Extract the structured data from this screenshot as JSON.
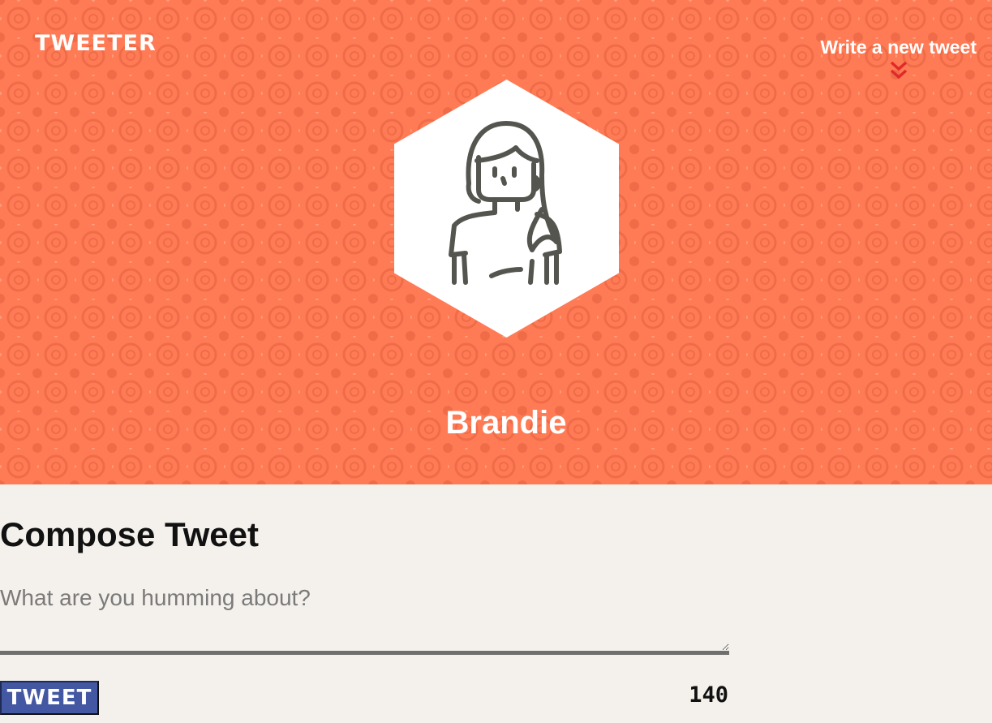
{
  "colors": {
    "header_background": "#ff7b55",
    "page_background": "#f4f1ec",
    "tweet_button": "#4357a2",
    "chevron": "#e02a2a"
  },
  "nav": {
    "brand": "TWEETER",
    "compose_link": "Write a new tweet",
    "compose_icon": "double-chevron-down-icon"
  },
  "profile": {
    "avatar_icon": "user-avatar-icon",
    "name": "Brandie"
  },
  "compose": {
    "title": "Compose Tweet",
    "placeholder": "What are you humming about?",
    "value": "",
    "button_label": "TWEET",
    "counter": "140"
  }
}
